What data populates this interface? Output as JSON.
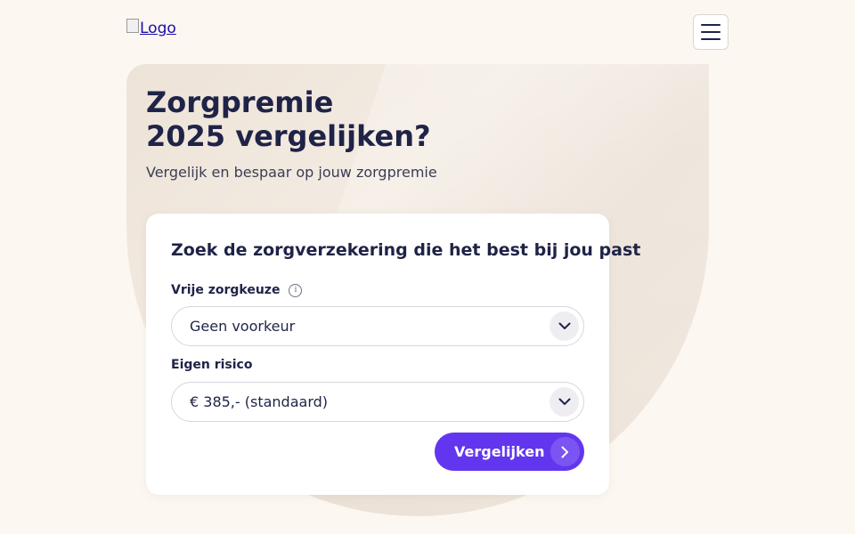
{
  "header": {
    "logo_alt": "Logo",
    "menu_icon": "hamburger-icon"
  },
  "hero": {
    "title_line1": "Zorgpremie",
    "title_line2": "2025 vergelijken?",
    "subtitle": "Vergelijk en bespaar op jouw zorgpremie"
  },
  "form": {
    "title": "Zoek de zorgverzekering die het best bij jou past",
    "vrije_zorgkeuze": {
      "label": "Vrije zorgkeuze",
      "info_icon": "info-icon",
      "value": "Geen voorkeur"
    },
    "eigen_risico": {
      "label": "Eigen risico",
      "value": "€ 385,- (standaard)"
    },
    "submit_label": "Vergelijken"
  },
  "colors": {
    "background": "#fdf7f1",
    "text": "#1f2347",
    "accent": "#6236ee"
  }
}
